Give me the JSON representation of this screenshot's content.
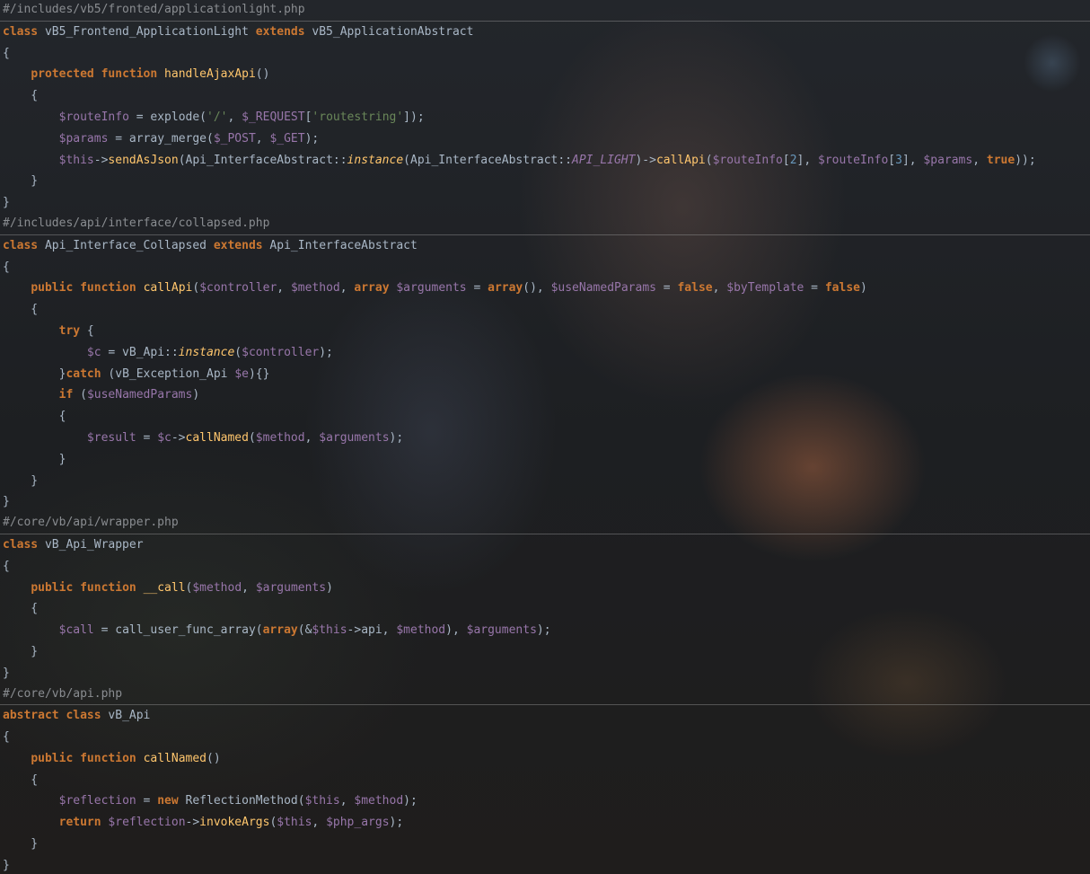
{
  "files": [
    {
      "path": "#/includes/vb5/fronted/applicationlight.php",
      "lines": [
        [
          [
            "kw",
            "class"
          ],
          [
            "pl",
            " vB5_Frontend_ApplicationLight "
          ],
          [
            "kw",
            "extends"
          ],
          [
            "pl",
            " vB5_ApplicationAbstract"
          ]
        ],
        [
          [
            "pl",
            "{"
          ]
        ],
        [
          [
            "pl",
            "    "
          ],
          [
            "kw",
            "protected"
          ],
          [
            "pl",
            " "
          ],
          [
            "kw",
            "function"
          ],
          [
            "pl",
            " "
          ],
          [
            "fn",
            "handleAjaxApi"
          ],
          [
            "pl",
            "()"
          ]
        ],
        [
          [
            "pl",
            "    {"
          ]
        ],
        [
          [
            "pl",
            "        "
          ],
          [
            "var",
            "$routeInfo"
          ],
          [
            "pl",
            " = explode("
          ],
          [
            "str",
            "'/'"
          ],
          [
            "pl",
            ", "
          ],
          [
            "var",
            "$_REQUEST"
          ],
          [
            "pl",
            "["
          ],
          [
            "str",
            "'routestring'"
          ],
          [
            "pl",
            "]);"
          ]
        ],
        [
          [
            "pl",
            "        "
          ],
          [
            "var",
            "$params"
          ],
          [
            "pl",
            " = array_merge("
          ],
          [
            "var",
            "$_POST"
          ],
          [
            "pl",
            ", "
          ],
          [
            "var",
            "$_GET"
          ],
          [
            "pl",
            ");"
          ]
        ],
        [
          [
            "pl",
            "        "
          ],
          [
            "var",
            "$this"
          ],
          [
            "pl",
            "->"
          ],
          [
            "fn",
            "sendAsJson"
          ],
          [
            "pl",
            "(Api_InterfaceAbstract::"
          ],
          [
            "fnit",
            "instance"
          ],
          [
            "pl",
            "(Api_InterfaceAbstract::"
          ],
          [
            "varit",
            "API_LIGHT"
          ],
          [
            "pl",
            ")->"
          ],
          [
            "fn",
            "callApi"
          ],
          [
            "pl",
            "("
          ],
          [
            "var",
            "$routeInfo"
          ],
          [
            "pl",
            "["
          ],
          [
            "num",
            "2"
          ],
          [
            "pl",
            "], "
          ],
          [
            "var",
            "$routeInfo"
          ],
          [
            "pl",
            "["
          ],
          [
            "num",
            "3"
          ],
          [
            "pl",
            "], "
          ],
          [
            "var",
            "$params"
          ],
          [
            "pl",
            ", "
          ],
          [
            "kw",
            "true"
          ],
          [
            "pl",
            "));"
          ]
        ],
        [
          [
            "pl",
            "    }"
          ]
        ],
        [
          [
            "pl",
            "}"
          ]
        ]
      ]
    },
    {
      "path": "#/includes/api/interface/collapsed.php",
      "lines": [
        [
          [
            "kw",
            "class"
          ],
          [
            "pl",
            " Api_Interface_Collapsed "
          ],
          [
            "kw",
            "extends"
          ],
          [
            "pl",
            " Api_InterfaceAbstract"
          ]
        ],
        [
          [
            "pl",
            "{"
          ]
        ],
        [
          [
            "pl",
            "    "
          ],
          [
            "kw",
            "public"
          ],
          [
            "pl",
            " "
          ],
          [
            "kw",
            "function"
          ],
          [
            "pl",
            " "
          ],
          [
            "fn",
            "callApi"
          ],
          [
            "pl",
            "("
          ],
          [
            "var",
            "$controller"
          ],
          [
            "pl",
            ", "
          ],
          [
            "var",
            "$method"
          ],
          [
            "pl",
            ", "
          ],
          [
            "kw",
            "array"
          ],
          [
            "pl",
            " "
          ],
          [
            "var",
            "$arguments"
          ],
          [
            "pl",
            " = "
          ],
          [
            "kw",
            "array"
          ],
          [
            "pl",
            "(), "
          ],
          [
            "var",
            "$useNamedParams"
          ],
          [
            "pl",
            " = "
          ],
          [
            "kw",
            "false"
          ],
          [
            "pl",
            ", "
          ],
          [
            "var",
            "$byTemplate"
          ],
          [
            "pl",
            " = "
          ],
          [
            "kw",
            "false"
          ],
          [
            "pl",
            ")"
          ]
        ],
        [
          [
            "pl",
            "    {"
          ]
        ],
        [
          [
            "pl",
            "        "
          ],
          [
            "kw",
            "try"
          ],
          [
            "pl",
            " {"
          ]
        ],
        [
          [
            "pl",
            "            "
          ],
          [
            "var",
            "$c"
          ],
          [
            "pl",
            " = vB_Api::"
          ],
          [
            "fnit",
            "instance"
          ],
          [
            "pl",
            "("
          ],
          [
            "var",
            "$controller"
          ],
          [
            "pl",
            ");"
          ]
        ],
        [
          [
            "pl",
            "        }"
          ],
          [
            "kw",
            "catch"
          ],
          [
            "pl",
            " (vB_Exception_Api "
          ],
          [
            "var",
            "$e"
          ],
          [
            "pl",
            "){}"
          ]
        ],
        [
          [
            "pl",
            "        "
          ],
          [
            "kw",
            "if"
          ],
          [
            "pl",
            " ("
          ],
          [
            "var",
            "$useNamedParams"
          ],
          [
            "pl",
            ")"
          ]
        ],
        [
          [
            "pl",
            "        {"
          ]
        ],
        [
          [
            "pl",
            "            "
          ],
          [
            "var",
            "$result"
          ],
          [
            "pl",
            " = "
          ],
          [
            "var",
            "$c"
          ],
          [
            "pl",
            "->"
          ],
          [
            "fn",
            "callNamed"
          ],
          [
            "pl",
            "("
          ],
          [
            "var",
            "$method"
          ],
          [
            "pl",
            ", "
          ],
          [
            "var",
            "$arguments"
          ],
          [
            "pl",
            ");"
          ]
        ],
        [
          [
            "pl",
            "        }"
          ]
        ],
        [
          [
            "pl",
            "    }"
          ]
        ],
        [
          [
            "pl",
            "}"
          ]
        ]
      ]
    },
    {
      "path": "#/core/vb/api/wrapper.php",
      "lines": [
        [
          [
            "kw",
            "class"
          ],
          [
            "pl",
            " vB_Api_Wrapper"
          ]
        ],
        [
          [
            "pl",
            "{"
          ]
        ],
        [
          [
            "pl",
            "    "
          ],
          [
            "kw",
            "public"
          ],
          [
            "pl",
            " "
          ],
          [
            "kw",
            "function"
          ],
          [
            "pl",
            " "
          ],
          [
            "fn",
            "__call"
          ],
          [
            "pl",
            "("
          ],
          [
            "var",
            "$method"
          ],
          [
            "pl",
            ", "
          ],
          [
            "var",
            "$arguments"
          ],
          [
            "pl",
            ")"
          ]
        ],
        [
          [
            "pl",
            "    {"
          ]
        ],
        [
          [
            "pl",
            "        "
          ],
          [
            "var",
            "$call"
          ],
          [
            "pl",
            " = call_user_func_array("
          ],
          [
            "kw",
            "array"
          ],
          [
            "pl",
            "(&"
          ],
          [
            "var",
            "$this"
          ],
          [
            "pl",
            "->api, "
          ],
          [
            "var",
            "$method"
          ],
          [
            "pl",
            "), "
          ],
          [
            "var",
            "$arguments"
          ],
          [
            "pl",
            ");"
          ]
        ],
        [
          [
            "pl",
            "    }"
          ]
        ],
        [
          [
            "pl",
            "}"
          ]
        ]
      ]
    },
    {
      "path": "#/core/vb/api.php",
      "lines": [
        [
          [
            "kw",
            "abstract"
          ],
          [
            "pl",
            " "
          ],
          [
            "kw",
            "class"
          ],
          [
            "pl",
            " vB_Api"
          ]
        ],
        [
          [
            "pl",
            "{"
          ]
        ],
        [
          [
            "pl",
            "    "
          ],
          [
            "kw",
            "public"
          ],
          [
            "pl",
            " "
          ],
          [
            "kw",
            "function"
          ],
          [
            "pl",
            " "
          ],
          [
            "fn",
            "callNamed"
          ],
          [
            "pl",
            "()"
          ]
        ],
        [
          [
            "pl",
            "    {"
          ]
        ],
        [
          [
            "pl",
            "        "
          ],
          [
            "var",
            "$reflection"
          ],
          [
            "pl",
            " = "
          ],
          [
            "kw",
            "new"
          ],
          [
            "pl",
            " ReflectionMethod("
          ],
          [
            "var",
            "$this"
          ],
          [
            "pl",
            ", "
          ],
          [
            "var",
            "$method"
          ],
          [
            "pl",
            ");"
          ]
        ],
        [
          [
            "pl",
            "        "
          ],
          [
            "kw",
            "return"
          ],
          [
            "pl",
            " "
          ],
          [
            "var",
            "$reflection"
          ],
          [
            "pl",
            "->"
          ],
          [
            "fn",
            "invokeArgs"
          ],
          [
            "pl",
            "("
          ],
          [
            "var",
            "$this"
          ],
          [
            "pl",
            ", "
          ],
          [
            "var",
            "$php_args"
          ],
          [
            "pl",
            ");"
          ]
        ],
        [
          [
            "pl",
            "    }"
          ]
        ],
        [
          [
            "pl",
            "}"
          ]
        ]
      ]
    }
  ],
  "colors": {
    "keyword": "#cc7832",
    "function": "#ffc66d",
    "variable": "#9876aa",
    "string": "#6a8759",
    "number": "#6897bb",
    "plain": "#a9b7c6",
    "path": "#8a8d91"
  }
}
